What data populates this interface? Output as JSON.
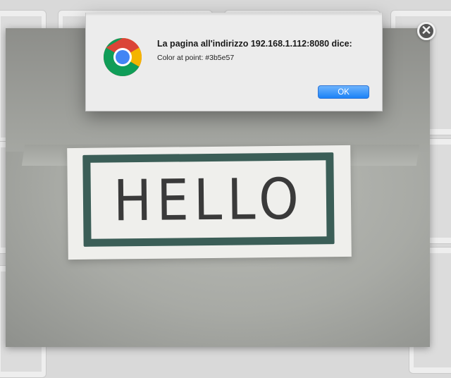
{
  "dialog": {
    "title": "La pagina all'indirizzo 192.168.1.112:8080 dice:",
    "message": "Color at point: #3b5e57",
    "ok_label": "OK",
    "icon": "chrome-icon"
  },
  "lightbox": {
    "close_label": "✕",
    "photo_text": "HELLO",
    "frame_color": "#3b5e57"
  },
  "colors": {
    "accent_button": "#1b82f7",
    "frame_green": "#3b5e57"
  }
}
